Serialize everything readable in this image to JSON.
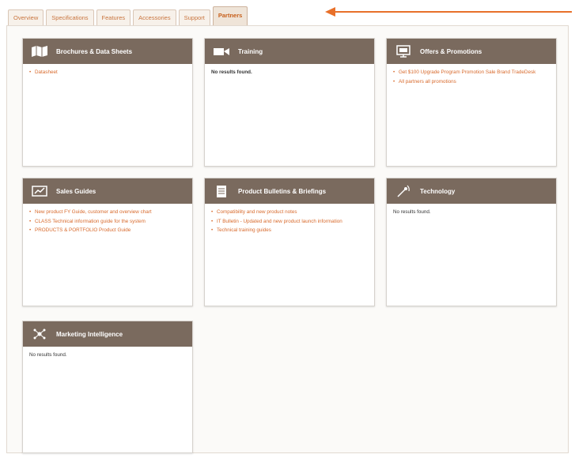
{
  "tabs": [
    {
      "label": "Overview",
      "active": false
    },
    {
      "label": "Specifications",
      "active": false
    },
    {
      "label": "Features",
      "active": false
    },
    {
      "label": "Accessories",
      "active": false
    },
    {
      "label": "Support",
      "active": false
    },
    {
      "label": "Partners",
      "active": true
    }
  ],
  "accent_color": "#e8702a",
  "cards": {
    "brochures": {
      "title": "Brochures & Data Sheets",
      "icon": "map-icon",
      "items": [
        "Datasheet"
      ]
    },
    "training": {
      "title": "Training",
      "icon": "video-icon",
      "empty_text": "No results found."
    },
    "offers": {
      "title": "Offers & Promotions",
      "icon": "display-icon",
      "items": [
        "Get $100 Upgrade Program Promotion Sale Brand TradeDesk",
        "All partners all promotions"
      ]
    },
    "sales": {
      "title": "Sales Guides",
      "icon": "presentation-icon",
      "items": [
        "New product FY Guide, customer and overview chart",
        "CLASS Technical information guide for the system",
        "PRODUCTS & PORTFOLIO Product Guide"
      ]
    },
    "product": {
      "title": "Product Bulletins & Briefings",
      "icon": "document-icon",
      "items": [
        "Compatibility and new product notes",
        "IT Bulletin - Updated and new product launch information",
        "Technical training guides"
      ]
    },
    "technology": {
      "title": "Technology",
      "icon": "antenna-icon",
      "empty_text": "No results found."
    },
    "marketing": {
      "title": "Marketing Intelligence",
      "icon": "network-icon",
      "empty_text": "No results found."
    }
  }
}
